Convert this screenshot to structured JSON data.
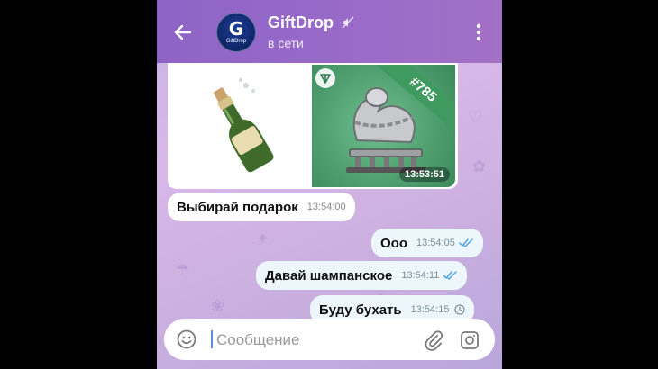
{
  "header": {
    "title": "GiftDrop",
    "status": "в сети",
    "avatar_letter": "G",
    "avatar_caption": "GiftDrop"
  },
  "gift": {
    "number": "#785",
    "time": "13:53:51"
  },
  "messages": [
    {
      "text": "Выбирай подарок",
      "time": "13:54:00",
      "direction": "in"
    },
    {
      "text": "Ооо",
      "time": "13:54:05",
      "direction": "out",
      "status": "read"
    },
    {
      "text": "Давай шампанское",
      "time": "13:54:11",
      "direction": "out",
      "status": "read"
    },
    {
      "text": "Буду бухать",
      "time": "13:54:15",
      "direction": "out",
      "status": "sending"
    }
  ],
  "input": {
    "placeholder": "Сообщение"
  },
  "icons": [
    "back-arrow-icon",
    "mute-icon",
    "menu-icon",
    "ton-icon",
    "check-icon",
    "clock-icon",
    "emoji-icon",
    "clip-icon",
    "camera-icon"
  ],
  "colors": {
    "header": "#9a6bc9",
    "bubble_out": "#ecf6fb",
    "check": "#4fa3e3"
  }
}
